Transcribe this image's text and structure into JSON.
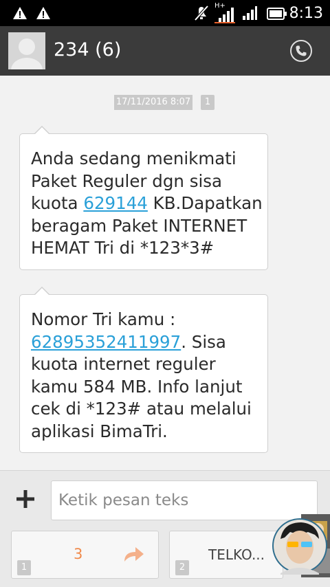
{
  "status_bar": {
    "time": "8:13",
    "network_type": "H+",
    "icons": [
      "warning-icon",
      "warning-icon",
      "mute-icon",
      "signal-icon",
      "signal-icon",
      "battery-icon"
    ]
  },
  "header": {
    "contact_title": "234 (6)",
    "avatar_icon": "default-contact-avatar",
    "call_icon": "phone-icon"
  },
  "conversation": {
    "timestamp": "17/11/2016 8:07",
    "sim_slot": "1",
    "messages": [
      {
        "lines": [
          {
            "text": "Anda sedang menikmati"
          },
          {
            "text": "Paket Reguler dgn sisa"
          },
          {
            "pre": "kuota ",
            "link": "629144",
            "post": " KB.Dapatkan"
          },
          {
            "text": "beragam Paket INTERNET"
          },
          {
            "text": "HEMAT Tri di *123*3#"
          }
        ]
      },
      {
        "lines": [
          {
            "text": "Nomor Tri kamu :"
          },
          {
            "link": "62895352411997",
            "post": ". Sisa"
          },
          {
            "text": "kuota internet reguler"
          },
          {
            "text": "kamu 584 MB. Info lanjut"
          },
          {
            "text": "cek di *123# atau melalui"
          },
          {
            "text": "aplikasi BimaTri."
          }
        ]
      }
    ]
  },
  "compose": {
    "input_value": "",
    "placeholder": "Ketik pesan teks",
    "attach_icon": "plus-icon",
    "send_buttons": [
      {
        "slot": "1",
        "count": "3",
        "icon": "send-arrow-icon"
      },
      {
        "slot": "2",
        "label": "TELKO..."
      }
    ]
  },
  "colors": {
    "status_bar_bg": "#000000",
    "header_bg": "#3b3b3b",
    "background": "#f2f2f2",
    "link": "#2aa0d8",
    "count_accent": "#f08a4b"
  }
}
